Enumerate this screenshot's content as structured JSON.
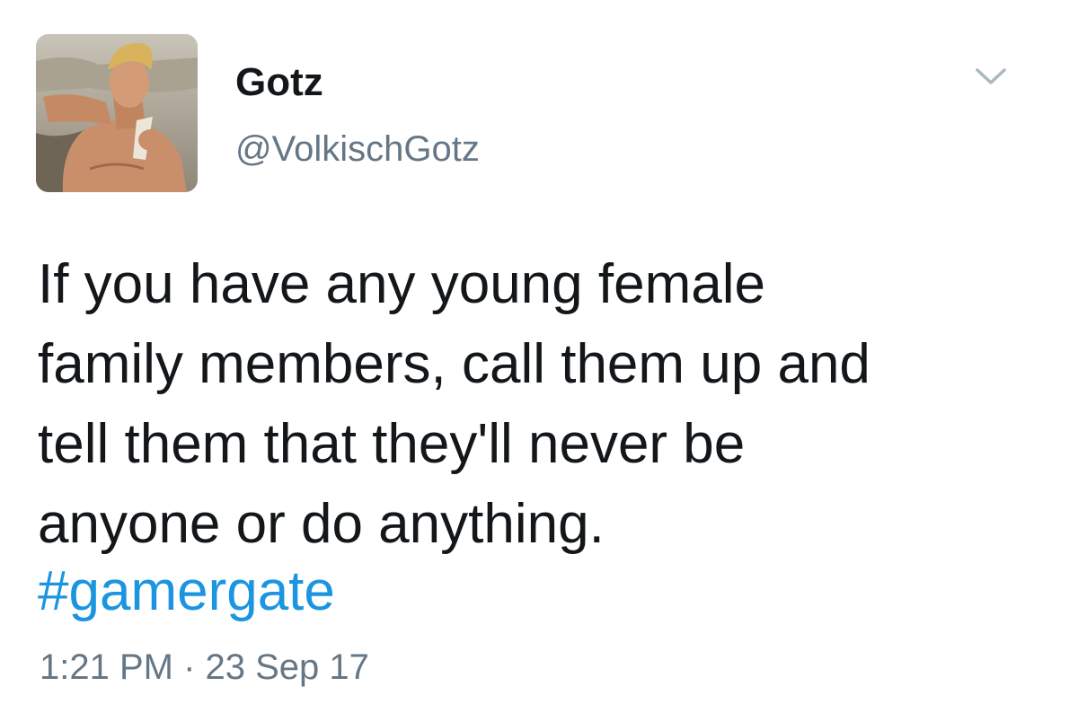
{
  "author": {
    "display_name": "Gotz",
    "handle": "@VolkischGotz"
  },
  "menu": {
    "icon": "chevron-down-icon"
  },
  "tweet": {
    "lines": [
      "If you have any young female",
      "family members, call them up and",
      "tell them that they'll never be",
      "anyone or do anything."
    ],
    "hashtag": "#gamergate",
    "timestamp": "1:21 PM · 23 Sep 17"
  },
  "colors": {
    "text": "#14171a",
    "secondary": "#657786",
    "link": "#1b95e0",
    "chevron": "#aab8c2"
  }
}
